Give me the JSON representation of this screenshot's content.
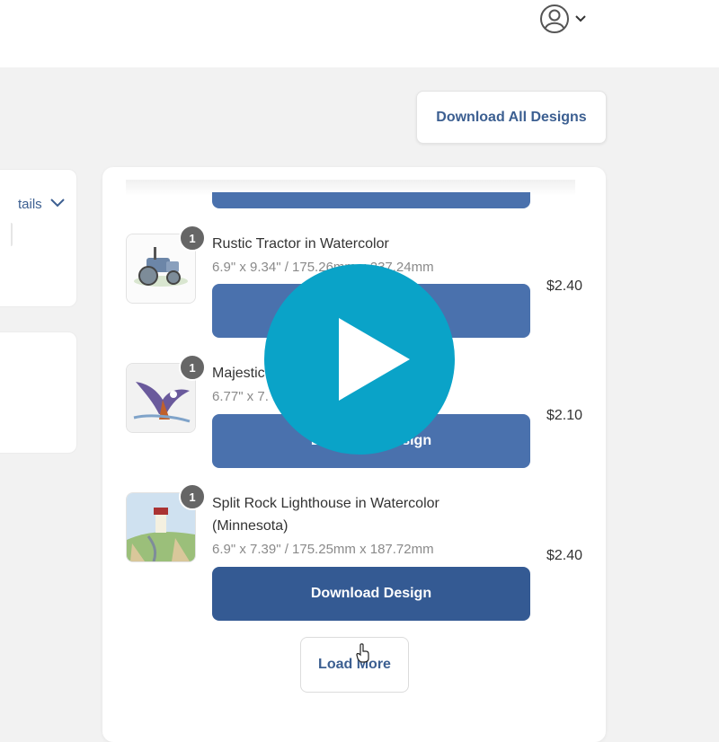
{
  "header": {
    "account_icon": "user-circle-icon",
    "account_chevron_icon": "chevron-down-icon"
  },
  "actions": {
    "download_all_label": "Download All Designs"
  },
  "sidebar": {
    "details_label_partial": "tails",
    "details_chevron_icon": "chevron-down-icon"
  },
  "items": [
    {
      "qty": "1",
      "title": "Rustic Tractor in Watercolor",
      "size": "6.9\" x 9.34\" / 175.26mm x 237.24mm",
      "price": "$2.40",
      "button_label": "Download Design",
      "thumb_icon": "tractor-watercolor-thumbnail"
    },
    {
      "qty": "1",
      "title": "Majestic",
      "size": "6.77\" x 7.",
      "price": "$2.10",
      "button_label": "Download Design",
      "thumb_icon": "eagle-watercolor-thumbnail"
    },
    {
      "qty": "1",
      "title": "Split Rock Lighthouse in Watercolor (Minnesota)",
      "size": "6.9\" x 7.39\" / 175.25mm x 187.72mm",
      "price": "$2.40",
      "button_label": "Download Design",
      "thumb_icon": "lighthouse-watercolor-thumbnail"
    }
  ],
  "pagination": {
    "load_more_label": "Load More"
  },
  "overlay": {
    "icon": "play-icon",
    "color": "#0aa3c8"
  },
  "colors": {
    "primary_button": "#4a71ad",
    "primary_button_active": "#345a93",
    "link_text": "#3c5f91",
    "page_background": "#f2f2f2"
  }
}
